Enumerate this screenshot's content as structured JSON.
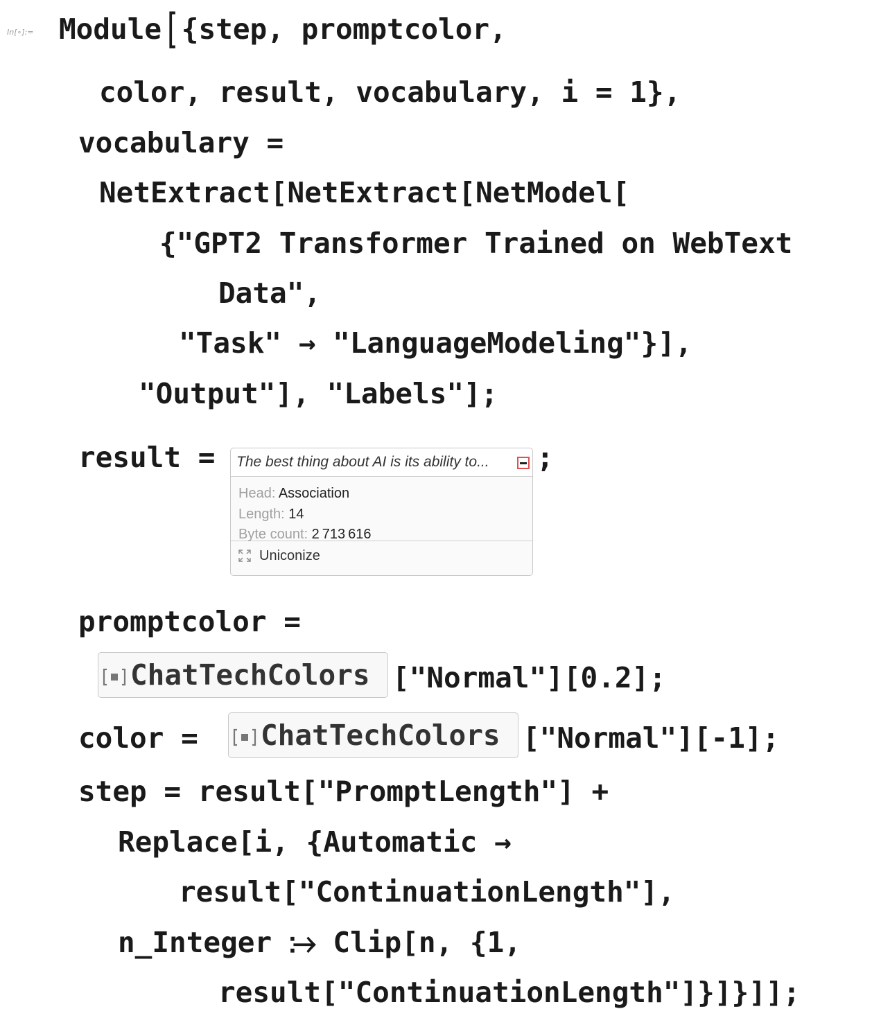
{
  "cell": {
    "label": "In[∘]:="
  },
  "code": {
    "l1_module": "Module",
    "l1_open": "[",
    "l1_rest": "{step, promptcolor,",
    "l2": "color, result, vocabulary, i = 1},",
    "l3": "vocabulary =",
    "l4": "NetExtract[NetExtract[NetModel[",
    "l5": "{\"GPT2 Transformer Trained on WebText",
    "l6": "Data\",",
    "l7": "\"Task\" → \"LanguageModeling\"}],",
    "l8": "\"Output\"], \"Labels\"];",
    "l9_lhs": "result =",
    "l9_end": ";",
    "l10": "promptcolor =",
    "l11_rest": "[\"Normal\"][0.2];",
    "l12_lhs": "color =",
    "l12_rest": "[\"Normal\"][-1];",
    "l13": "step = result[\"PromptLength\"] +",
    "l14": "Replace[i, {Automatic →",
    "l15": "result[\"ContinuationLength\"],",
    "l16": "n_Integer ⧴ Clip[n, {1,",
    "l17": "result[\"ContinuationLength\"]}]}]];"
  },
  "iconized": {
    "summary": "The best thing about AI is its ability to...",
    "head_label": "Head:",
    "head_value": "Association",
    "length_label": "Length:",
    "length_value": "14",
    "bytes_label": "Byte count:",
    "bytes_value": "2 713 616",
    "uniconize_label": "Uniconize"
  },
  "resource_function": {
    "name": "ChatTechColors",
    "icon": "resource-function-icon"
  },
  "colors": {
    "collapse_border": "#e05050",
    "box_border": "#c8c8c8",
    "label_gray": "#a0a0a0"
  }
}
